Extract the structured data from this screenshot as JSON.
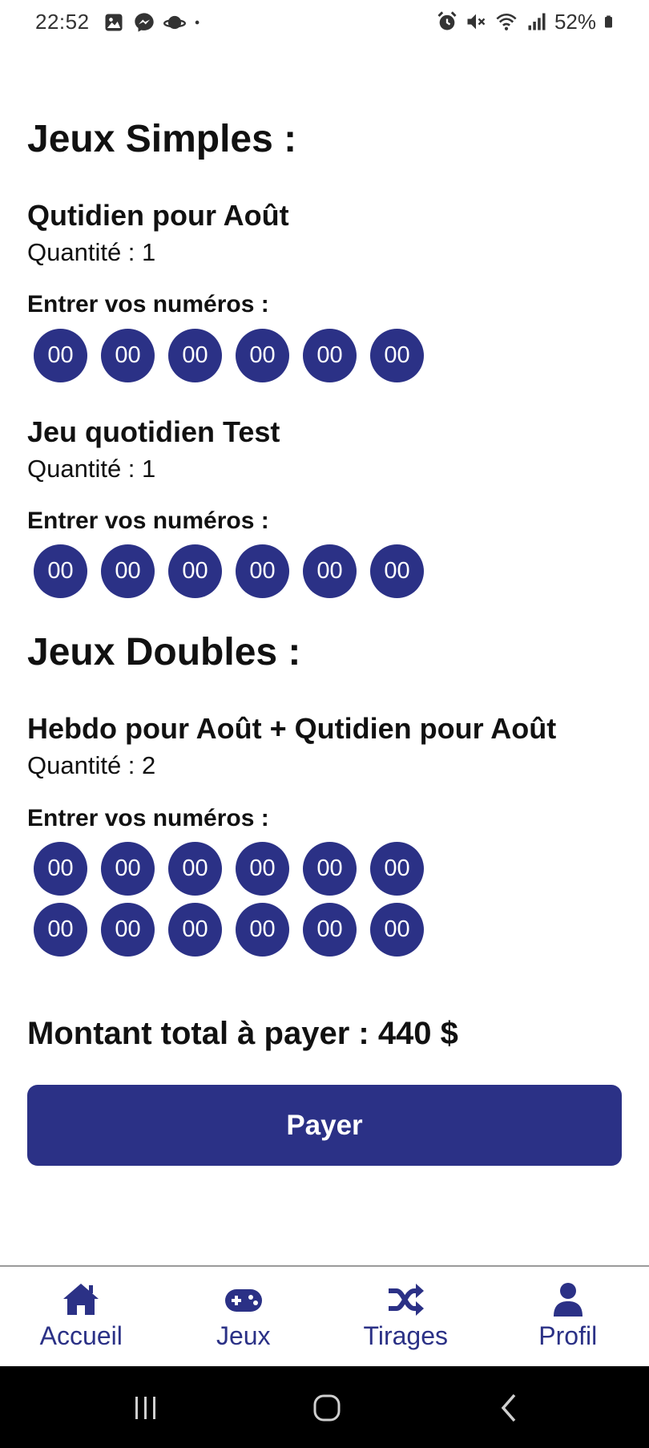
{
  "status_bar": {
    "time": "22:52",
    "battery": "52%",
    "left_icons": [
      "image-icon",
      "messenger-icon",
      "planet-icon",
      "dot-icon"
    ],
    "right_icons": [
      "alarm-icon",
      "mute-icon",
      "wifi-icon",
      "signal-icon",
      "battery-icon"
    ]
  },
  "sections": {
    "simple_title": "Jeux Simples :",
    "double_title": "Jeux Doubles :"
  },
  "games": [
    {
      "name": "Qutidien pour Août",
      "quantity": "Quantité : 1",
      "enter_label": "Entrer vos numéros :"
    },
    {
      "name": "Jeu quotidien Test",
      "quantity": "Quantité : 1",
      "enter_label": "Entrer vos numéros :"
    },
    {
      "name": "Hebdo pour Août + Qutidien pour Août",
      "quantity": "Quantité : 2",
      "enter_label": "Entrer vos numéros :"
    }
  ],
  "number_rows": [
    [
      "00",
      "00",
      "00",
      "00",
      "00",
      "00"
    ],
    [
      "00",
      "00",
      "00",
      "00",
      "00",
      "00"
    ],
    [
      "00",
      "00",
      "00",
      "00",
      "00",
      "00"
    ],
    [
      "00",
      "00",
      "00",
      "00",
      "00",
      "00"
    ]
  ],
  "total": "Montant total à payer : 440 $",
  "pay_button": "Payer",
  "bottom_nav": [
    {
      "label": "Accueil",
      "icon": "home-icon"
    },
    {
      "label": "Jeux",
      "icon": "gamepad-icon"
    },
    {
      "label": "Tirages",
      "icon": "shuffle-icon"
    },
    {
      "label": "Profil",
      "icon": "user-icon"
    }
  ],
  "system_nav": [
    "recents-icon",
    "home-circle-icon",
    "back-icon"
  ],
  "colors": {
    "accent": "#2b3186",
    "text": "#111111",
    "background": "#ffffff",
    "system_bar": "#000000"
  }
}
